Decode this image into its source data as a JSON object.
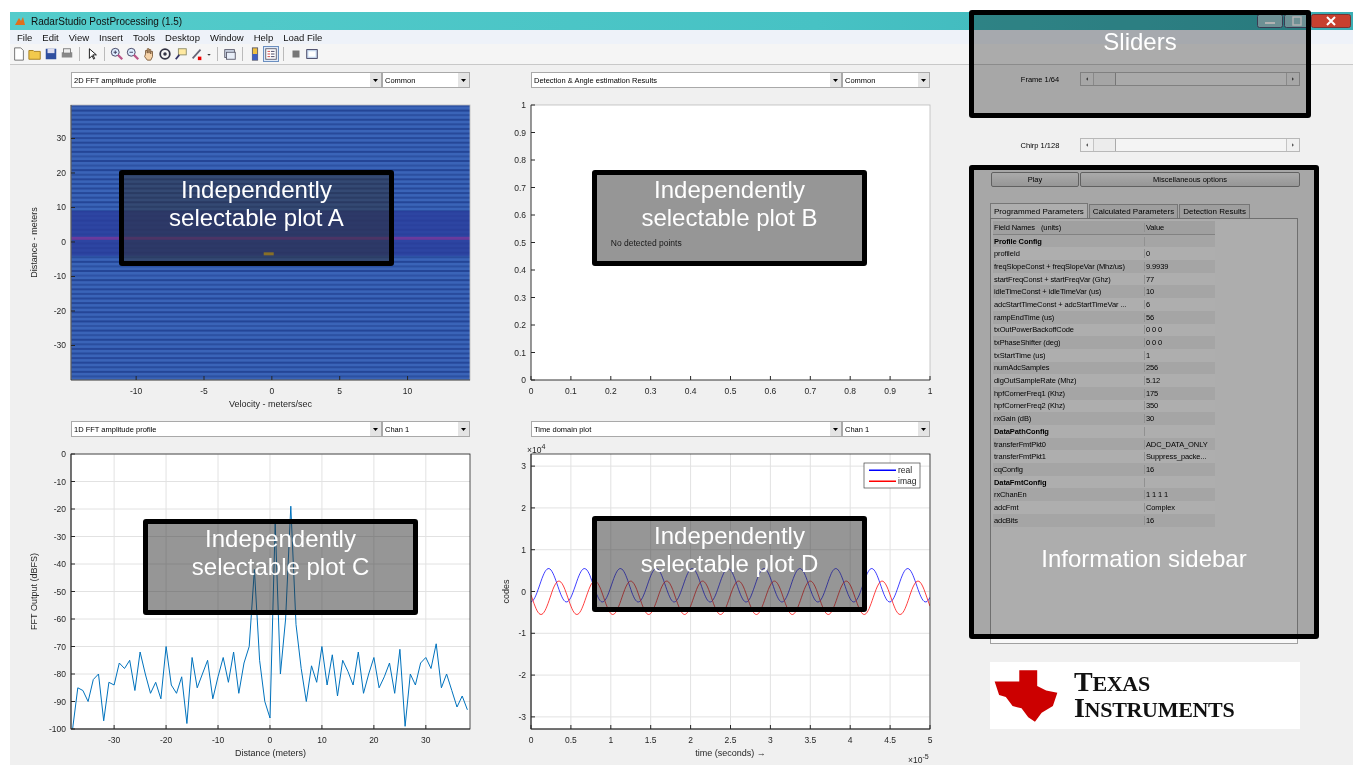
{
  "window": {
    "title": "RadarStudio PostProcessing (1.5)"
  },
  "menu": [
    "File",
    "Edit",
    "View",
    "Insert",
    "Tools",
    "Desktop",
    "Window",
    "Help",
    "Load File"
  ],
  "plots": [
    {
      "kind": "heatmap",
      "selector": "2D FFT amplitude profile",
      "option": "Common",
      "axes": {
        "grid": false,
        "xlabel": "Velocity - meters/sec",
        "ylabel": "Distance - meters",
        "xticks": [
          "-10",
          "-5",
          "0",
          "5",
          "10"
        ],
        "yticks": [
          "30",
          "20",
          "10",
          "0",
          "-10",
          "-20",
          "-30"
        ]
      }
    },
    {
      "selector": "Detection & Angle estimation Results",
      "option": "Common",
      "chart_data": {
        "type": "scatter",
        "grid": false,
        "xlim": [
          0,
          1
        ],
        "ylim": [
          0,
          1
        ],
        "xticks": [
          0,
          0.1,
          0.2,
          0.3,
          0.4,
          0.5,
          0.6,
          0.7,
          0.8,
          0.9,
          1
        ],
        "yticks": [
          0,
          0.1,
          0.2,
          0.3,
          0.4,
          0.5,
          0.6,
          0.7,
          0.8,
          0.9,
          1
        ],
        "annotations": [
          "No detected points"
        ]
      }
    },
    {
      "selector": "1D FFT amplitude profile",
      "option": "Chan 1",
      "chart_data": {
        "type": "line",
        "grid": true,
        "xlabel": "Distance (meters)",
        "ylabel": "FFT Output (dBFS)",
        "xlim": [
          -38.3,
          38.5
        ],
        "ylim": [
          -100,
          0
        ],
        "xticks": [
          -30,
          -20,
          -10,
          0,
          10,
          20,
          30
        ],
        "yticks": [
          -100,
          -90,
          -80,
          -70,
          -60,
          -50,
          -40,
          -30,
          -20,
          -10,
          0
        ],
        "x": [
          -38,
          -37,
          -36,
          -35,
          -34,
          -33,
          -32,
          -31,
          -30,
          -29,
          -28,
          -27,
          -26,
          -25,
          -24,
          -23,
          -22,
          -21,
          -20,
          -19,
          -18,
          -17,
          -16,
          -15,
          -14,
          -13,
          -12,
          -11,
          -10,
          -9,
          -8,
          -7,
          -6,
          -5,
          -4,
          -3,
          -2,
          -1,
          0,
          1,
          2,
          3,
          4,
          5,
          6,
          7,
          8,
          9,
          10,
          11,
          12,
          13,
          14,
          15,
          16,
          17,
          18,
          19,
          20,
          21,
          22,
          23,
          24,
          25,
          26,
          27,
          28,
          29,
          30,
          31,
          32,
          33,
          34,
          35,
          36,
          37,
          38
        ],
        "series": [
          {
            "color": "#0072bd",
            "values": [
              -100,
              -85,
              -86,
              -90,
              -82,
              -80,
              -97,
              -83,
              -84,
              -76,
              -78,
              -75,
              -86,
              -72,
              -80,
              -87,
              -83,
              -89,
              -70,
              -84,
              -87,
              -81,
              -98,
              -74,
              -85,
              -80,
              -75,
              -89,
              -81,
              -74,
              -83,
              -72,
              -87,
              -76,
              -70,
              -42,
              -75,
              -90,
              -96,
              -25,
              -80,
              -60,
              -19,
              -62,
              -78,
              -90,
              -77,
              -83,
              -70,
              -84,
              -73,
              -88,
              -75,
              -79,
              -84,
              -72,
              -87,
              -80,
              -74,
              -85,
              -81,
              -76,
              -87,
              -71,
              -99,
              -80,
              -84,
              -76,
              -74,
              -78,
              -69,
              -85,
              -80,
              -86,
              -92,
              -88,
              -93
            ]
          }
        ]
      }
    },
    {
      "kind": "waveform",
      "selector": "Time domain plot",
      "option": "Chan 1",
      "axes": {
        "grid": true,
        "xlabel": "time  (seconds) →",
        "ylabel": "codes",
        "xticks": [
          "0",
          "0.5",
          "1",
          "1.5",
          "2",
          "2.5",
          "3",
          "3.5",
          "4",
          "4.5",
          "5"
        ],
        "yticks": [
          "3",
          "2",
          "1",
          "0",
          "-1",
          "-2",
          "-3"
        ],
        "y_multiplier": "×10$^{4}$",
        "x_multiplier": "×10$^{-5}$"
      },
      "legend": [
        {
          "label": "real",
          "color": "#0000ff"
        },
        {
          "label": "imag",
          "color": "#ff0000"
        }
      ]
    }
  ],
  "sliders": [
    {
      "label": "Frame 1/64",
      "level": 0
    },
    {
      "label": "Chirp 1/128",
      "level": 0
    }
  ],
  "buttons": [
    "Play",
    "Miscellaneous options"
  ],
  "tabs": [
    {
      "label": "Programmed Parameters",
      "selected": true
    },
    {
      "label": "Calculated Parameters",
      "selected": false
    },
    {
      "label": "Detection Results",
      "selected": false
    }
  ],
  "table": {
    "columns": [
      "Field Names   (units)",
      "Value"
    ],
    "rows": [
      {
        "kind": "section",
        "name": "Profile Config"
      },
      {
        "kind": "field",
        "name": "profileId",
        "value": "0"
      },
      {
        "kind": "field",
        "name": "freqSlopeConst + freqSlopeVar (Mhz/us)",
        "value": "9.9939"
      },
      {
        "kind": "field",
        "name": "startFreqConst + startFreqVar (Ghz)",
        "value": "77"
      },
      {
        "kind": "field",
        "name": "idleTimeConst + idleTimeVar (us)",
        "value": "10"
      },
      {
        "kind": "field",
        "name": "adcStartTimeConst + adcStartTimeVar ...",
        "value": "6"
      },
      {
        "kind": "field",
        "name": "rampEndTime (us)",
        "value": "56"
      },
      {
        "kind": "field",
        "name": "txOutPowerBackoffCode",
        "value": "0 0 0"
      },
      {
        "kind": "field",
        "name": "txPhaseShifter (deg)",
        "value": "0 0 0"
      },
      {
        "kind": "field",
        "name": "txStartTime (us)",
        "value": "1"
      },
      {
        "kind": "field",
        "name": "numAdcSamples",
        "value": "256"
      },
      {
        "kind": "field",
        "name": "digOutSampleRate (Mhz)",
        "value": "5.12"
      },
      {
        "kind": "field",
        "name": "hpfCornerFreq1 (Khz)",
        "value": "175"
      },
      {
        "kind": "field",
        "name": "hpfCornerFreq2 (Khz)",
        "value": "350"
      },
      {
        "kind": "field",
        "name": "rxGain (dB)",
        "value": "30"
      },
      {
        "kind": "section",
        "name": "DataPathConfig"
      },
      {
        "kind": "field",
        "name": "transferFmtPkt0",
        "value": "ADC_DATA_ONLY"
      },
      {
        "kind": "field",
        "name": "transferFmtPkt1",
        "value": "Suppress_packe..."
      },
      {
        "kind": "field",
        "name": "cqConfig",
        "value": "16"
      },
      {
        "kind": "section",
        "name": "DataFmtConfig"
      },
      {
        "kind": "field",
        "name": "rxChanEn",
        "value": "1 1 1 1"
      },
      {
        "kind": "field",
        "name": "adcFmt",
        "value": "Complex"
      },
      {
        "kind": "field",
        "name": "adcBits",
        "value": "16"
      }
    ]
  },
  "logo": {
    "lines": [
      "TEXAS",
      "INSTRUMENTS"
    ]
  },
  "callouts": [
    "Independently selectable plot A",
    "Independently selectable plot B",
    "Independently selectable plot C",
    "Independently selectable plot D",
    "Sliders",
    "Information sidebar"
  ]
}
